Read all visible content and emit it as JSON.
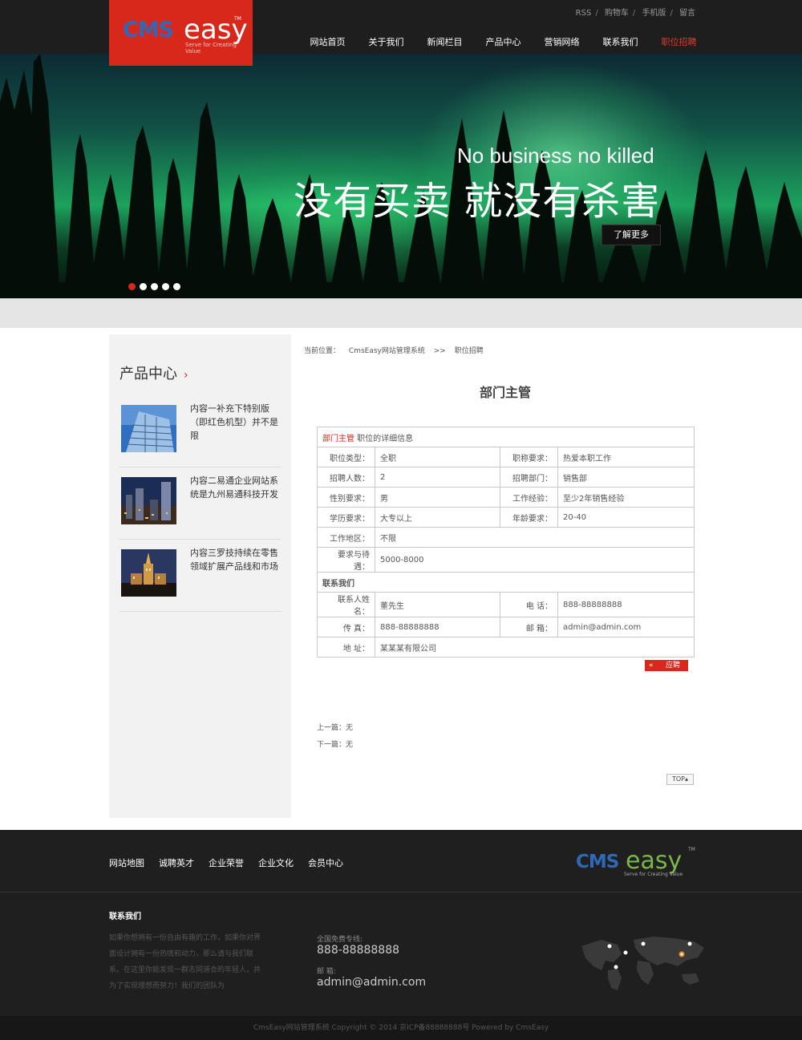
{
  "brand": {
    "logo_cms": "CMS",
    "logo_easy": "easy",
    "logo_tm": "TM",
    "slogan": "Serve for Creating Value",
    "accent": "#d8281c"
  },
  "toplinks": [
    "RSS",
    "购物车",
    "手机版",
    "留言"
  ],
  "nav": [
    {
      "label": "网站首页",
      "active": false
    },
    {
      "label": "关于我们",
      "active": false
    },
    {
      "label": "新闻栏目",
      "active": false
    },
    {
      "label": "产品中心",
      "active": false
    },
    {
      "label": "营销网络",
      "active": false
    },
    {
      "label": "联系我们",
      "active": false
    },
    {
      "label": "职位招聘",
      "active": true
    }
  ],
  "banner": {
    "english": "No business no killed",
    "chinese": "没有买卖 就没有杀害",
    "button": "了解更多",
    "active_slide": 1,
    "slide_count": 5
  },
  "sidebar": {
    "title": "产品中心",
    "chevron": "›",
    "items": [
      {
        "text": "内容一补充下特别版（即红色机型）并不是限"
      },
      {
        "text": "内容二易通企业网站系统是九州易通科技开发"
      },
      {
        "text": "内容三罗技持续在零售领域扩展产品线和市场"
      }
    ]
  },
  "breadcrumb": {
    "prefix": "当前位置：",
    "site": "CmsEasy网站管理系统",
    "sep": ">>",
    "current": "职位招聘"
  },
  "job": {
    "title": "部门主管",
    "header_highlight": "部门主管",
    "header_rest": " 职位的详细信息",
    "rows": [
      {
        "l1": "职位类型：",
        "v1": "全职",
        "l2": "职称要求：",
        "v2": "热爱本职工作"
      },
      {
        "l1": "招聘人数：",
        "v1": "2",
        "l2": "招聘部门：",
        "v2": "销售部"
      },
      {
        "l1": "性别要求：",
        "v1": "男",
        "l2": "工作经验：",
        "v2": "至少2年销售经验"
      },
      {
        "l1": "学历要求：",
        "v1": "大专以上",
        "l2": "年龄要求：",
        "v2": "20-40"
      }
    ],
    "work_area_label": "工作地区：",
    "work_area": "不限",
    "salary_label": "要求与待遇：",
    "salary": "5000-8000",
    "contact_header": "联系我们",
    "contact_name_label": "联系人姓名：",
    "contact_name": "董先生",
    "phone_label": "电 话：",
    "phone": "888-88888888",
    "fax_label": "传 真：",
    "fax": "888-88888888",
    "email_label": "邮 箱：",
    "email": "admin@admin.com",
    "address_label": "地 址：",
    "address": "某某某有限公司",
    "apply_arrow": "«",
    "apply": "应聘"
  },
  "prevnext": {
    "prev": "上一篇：无",
    "next": "下一篇：无"
  },
  "top_button": "TOP▴",
  "footer": {
    "links": [
      "网站地图",
      "诚聘英才",
      "企业荣誉",
      "企业文化",
      "会员中心"
    ],
    "contact_title": "联系我们",
    "contact_desc": "如果你想拥有一份自由有趣的工作，如果你对界面设计拥有一份热情和动力，那么请与我们联系。在这里你能发现一群志同道合的年轻人，并为了实现理想而努力！我们的团队为",
    "hotline_label": "全国免费专线:",
    "hotline": "888-88888888",
    "email_label": "邮 箱:",
    "email": "admin@admin.com",
    "copyright": "CmsEasy网站管理系统  Copyright © 2014  京ICP备88888888号  Powered by CmsEasy"
  }
}
